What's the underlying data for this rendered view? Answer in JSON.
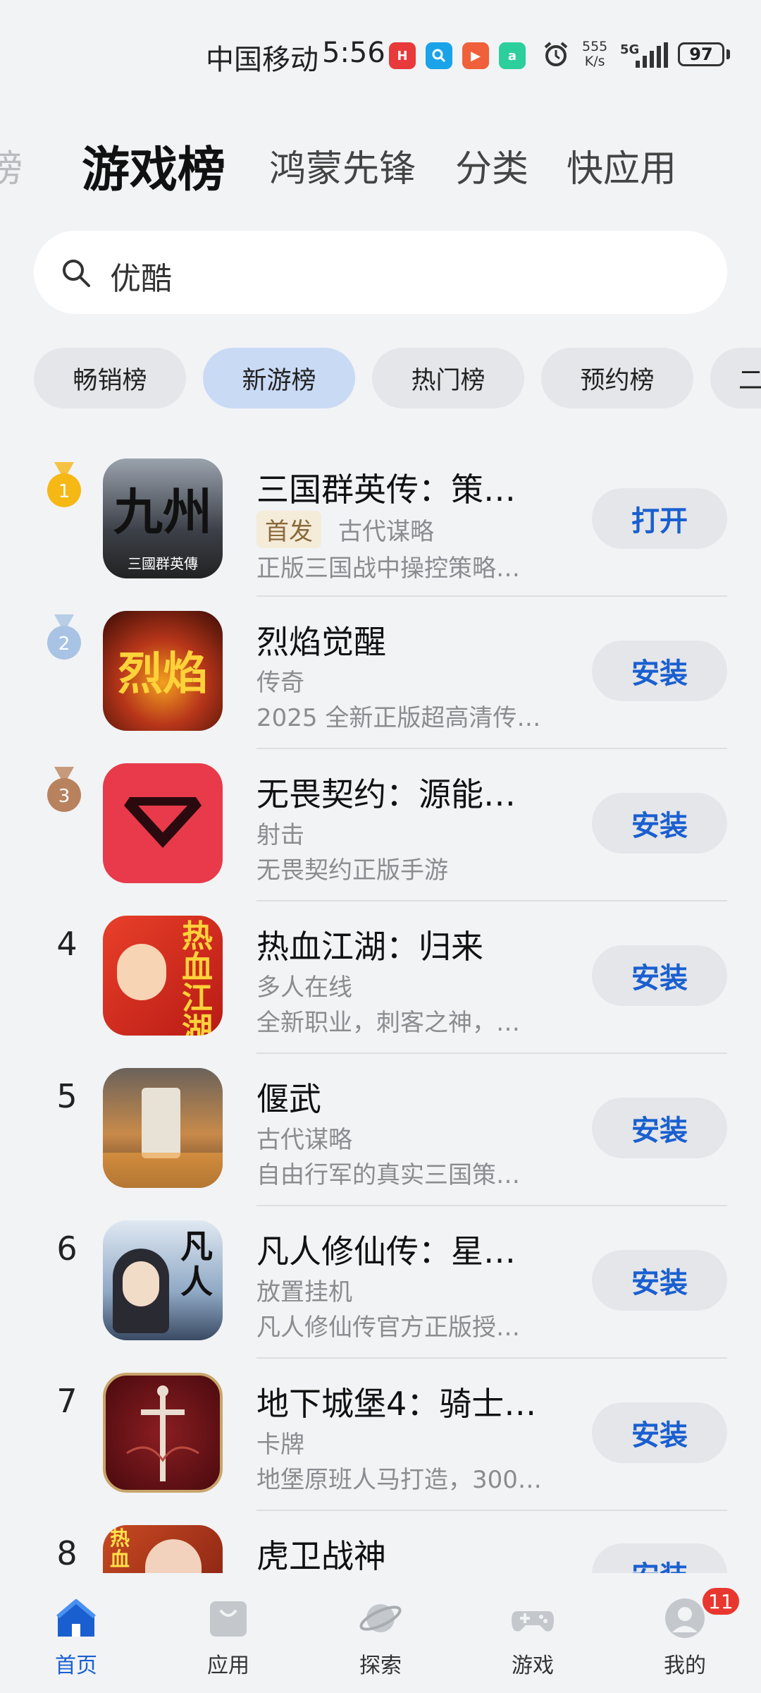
{
  "status_bar": {
    "carrier": "中国移动",
    "time": "5:56",
    "net_speed_value": "555",
    "net_speed_unit": "K/s",
    "network": "5G",
    "battery": "97"
  },
  "top_tabs": [
    {
      "label": "榜"
    },
    {
      "label": "游戏榜"
    },
    {
      "label": "鸿蒙先锋"
    },
    {
      "label": "分类"
    },
    {
      "label": "快应用"
    }
  ],
  "search": {
    "text": "优酷"
  },
  "chips": [
    {
      "label": "畅销榜"
    },
    {
      "label": "新游榜"
    },
    {
      "label": "热门榜"
    },
    {
      "label": "预约榜"
    },
    {
      "label": "二"
    }
  ],
  "apps": [
    {
      "rank": "1",
      "name": "三国群英传：策…",
      "tag": "首发",
      "category": "古代谋略",
      "desc": "正版三国战中操控策略…",
      "action": "打开",
      "icon_text": "九州",
      "icon_sub": "三國群英傳",
      "icon_bg": "#3c4048"
    },
    {
      "rank": "2",
      "name": "烈焰觉醒",
      "category": "传奇",
      "desc": "2025 全新正版超高清传…",
      "action": "安装",
      "icon_text": "烈焰",
      "icon_bg": "#7a1c10"
    },
    {
      "rank": "3",
      "name": "无畏契约：源能…",
      "category": "射击",
      "desc": "无畏契约正版手游",
      "action": "安装",
      "icon_text": "V",
      "icon_bg": "#e83a4a"
    },
    {
      "rank": "4",
      "name": "热血江湖：归来",
      "category": "多人在线",
      "desc": "全新职业，刺客之神，…",
      "action": "安装",
      "icon_text": "热血江湖",
      "icon_bg": "#d8281e"
    },
    {
      "rank": "5",
      "name": "偃武",
      "category": "古代谋略",
      "desc": "自由行军的真实三国策…",
      "action": "安装",
      "icon_text": "",
      "icon_bg": "#8a6a4e"
    },
    {
      "rank": "6",
      "name": "凡人修仙传：星…",
      "category": "放置挂机",
      "desc": "凡人修仙传官方正版授…",
      "action": "安装",
      "icon_text": "凡人",
      "icon_bg": "#6f8fb0"
    },
    {
      "rank": "7",
      "name": "地下城堡4：骑士…",
      "category": "卡牌",
      "desc": "地堡原班人马打造，300…",
      "action": "安装",
      "icon_text": "",
      "icon_bg": "#6b1418"
    },
    {
      "rank": "8",
      "name": "虎卫战神",
      "category": "",
      "desc": "",
      "action": "安装",
      "icon_text": "热血",
      "icon_bg": "#b8361e"
    }
  ],
  "bottom_nav": [
    {
      "label": "首页",
      "icon": "home-icon"
    },
    {
      "label": "应用",
      "icon": "bag-icon"
    },
    {
      "label": "探索",
      "icon": "planet-icon"
    },
    {
      "label": "游戏",
      "icon": "gamepad-icon"
    },
    {
      "label": "我的",
      "icon": "profile-icon",
      "badge": "11"
    }
  ],
  "colors": {
    "accent": "#1a5fd0",
    "chip_active": "#c9daf5",
    "badge": "#e8372f"
  }
}
